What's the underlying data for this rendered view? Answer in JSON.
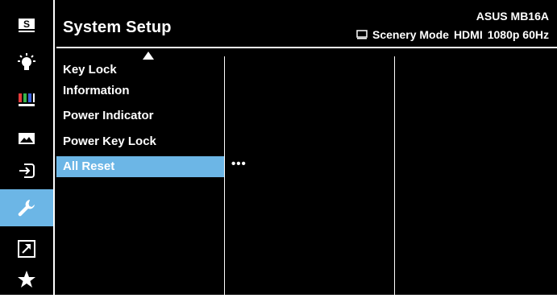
{
  "header": {
    "title": "System Setup",
    "model": "ASUS MB16A",
    "status": {
      "mode": "Scenery Mode",
      "input": "HDMI",
      "resolution": "1080p 60Hz"
    }
  },
  "rail": {
    "items": [
      {
        "name": "splendid",
        "icon": "s-box-icon"
      },
      {
        "name": "blue-light-filter",
        "icon": "bulb-icon"
      },
      {
        "name": "color",
        "icon": "color-bars-icon"
      },
      {
        "name": "image",
        "icon": "mountain-image-icon"
      },
      {
        "name": "input-select",
        "icon": "input-arrow-icon"
      },
      {
        "name": "system-setup",
        "icon": "wrench-icon",
        "active": true
      },
      {
        "name": "shortcut",
        "icon": "shortcut-arrow-icon"
      },
      {
        "name": "myfavorite",
        "icon": "star-icon"
      }
    ]
  },
  "menu": {
    "items": [
      {
        "label": "Key Lock"
      },
      {
        "label": "Information"
      },
      {
        "label": "Power Indicator"
      },
      {
        "label": "Power Key Lock"
      },
      {
        "label": "All Reset",
        "selected": true
      }
    ],
    "submenu_indicator": "•••"
  },
  "colors": {
    "background": "#000000",
    "highlight": "#6cb6e6",
    "text": "#ffffff"
  }
}
